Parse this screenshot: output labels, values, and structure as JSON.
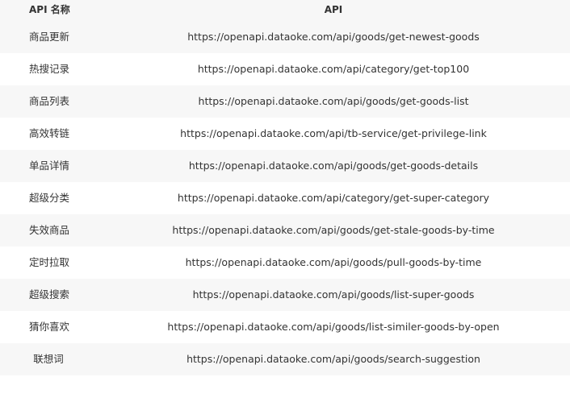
{
  "table": {
    "headers": {
      "name": "API 名称",
      "url": "API"
    },
    "rows": [
      {
        "name": "商品更新",
        "url": "https://openapi.dataoke.com/api/goods/get-newest-goods"
      },
      {
        "name": "热搜记录",
        "url": "https://openapi.dataoke.com/api/category/get-top100"
      },
      {
        "name": "商品列表",
        "url": "https://openapi.dataoke.com/api/goods/get-goods-list"
      },
      {
        "name": "高效转链",
        "url": "https://openapi.dataoke.com/api/tb-service/get-privilege-link"
      },
      {
        "name": "单品详情",
        "url": "https://openapi.dataoke.com/api/goods/get-goods-details"
      },
      {
        "name": "超级分类",
        "url": "https://openapi.dataoke.com/api/category/get-super-category"
      },
      {
        "name": "失效商品",
        "url": "https://openapi.dataoke.com/api/goods/get-stale-goods-by-time"
      },
      {
        "name": "定时拉取",
        "url": "https://openapi.dataoke.com/api/goods/pull-goods-by-time"
      },
      {
        "name": "超级搜索",
        "url": "https://openapi.dataoke.com/api/goods/list-super-goods"
      },
      {
        "name": "猜你喜欢",
        "url": "https://openapi.dataoke.com/api/goods/list-similer-goods-by-open"
      },
      {
        "name": "联想词",
        "url": "https://openapi.dataoke.com/api/goods/search-suggestion"
      }
    ]
  }
}
